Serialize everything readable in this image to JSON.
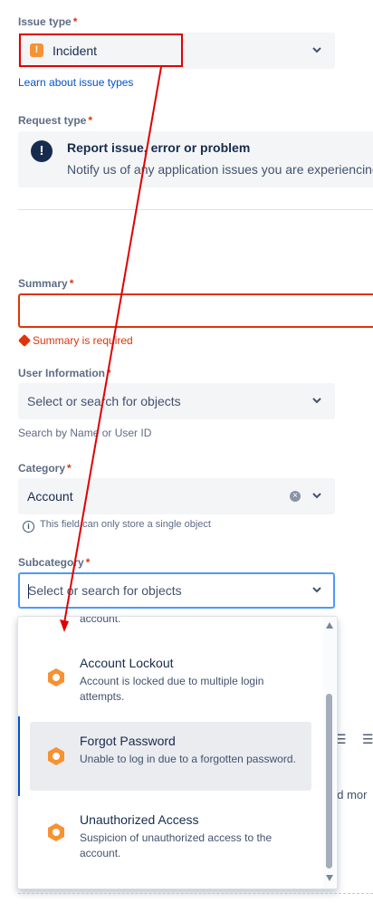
{
  "issue_type": {
    "label": "Issue type",
    "required": "*",
    "value": "Incident",
    "link": "Learn about issue types"
  },
  "request_type": {
    "label": "Request type",
    "required": "*",
    "title": "Report issue, error or problem",
    "description": "Notify us of any application issues you are experiencing"
  },
  "summary": {
    "label": "Summary",
    "required": "*",
    "error": "Summary is required"
  },
  "user_information": {
    "label": "User Information",
    "required": "*",
    "placeholder": "Select or search for objects",
    "helper": "Search by Name or User ID"
  },
  "category": {
    "label": "Category",
    "required": "*",
    "value": "Account",
    "helper": "This field can only store a single object"
  },
  "subcategory": {
    "label": "Subcategory",
    "required": "*",
    "placeholder": "Select or search for objects"
  },
  "dropdown": {
    "partial_text": "account.",
    "items": [
      {
        "title": "Account Lockout",
        "description": "Account is locked due to multiple login attempts."
      },
      {
        "title": "Forgot Password",
        "description": "Unable to log in due to a forgotten password."
      },
      {
        "title": "Unauthorized Access",
        "description": "Suspicion of unauthorized access to the account."
      }
    ]
  },
  "background": {
    "partial_text": "nd mor"
  },
  "colors": {
    "accent": "#0052cc",
    "error": "#de350b",
    "annotation": "#e00000",
    "object_icon": "#f79232"
  }
}
